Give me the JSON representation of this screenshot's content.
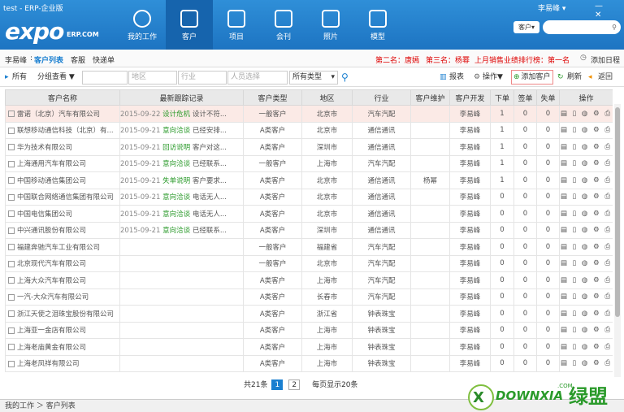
{
  "window": {
    "title": "test - ERP-企业版",
    "controls": "— ✕"
  },
  "logo": {
    "text": "expo",
    "sub": "ERP.COM"
  },
  "nav": [
    {
      "label": "我的工作",
      "icon": "person-icon"
    },
    {
      "label": "客户",
      "icon": "bag-icon",
      "active": true
    },
    {
      "label": "项目",
      "icon": "grid-icon"
    },
    {
      "label": "会刊",
      "icon": "book-icon"
    },
    {
      "label": "照片",
      "icon": "photo-icon"
    },
    {
      "label": "模型",
      "icon": "cube-icon"
    }
  ],
  "user": "李易峰 ▾",
  "search": {
    "scope": "客户",
    "scope_arrow": "▾",
    "placeholder": "",
    "icon": "search-icon"
  },
  "crumbs": {
    "user": "李易峰",
    "sep": ":",
    "current": "客户列表",
    "b": "客服",
    "c": "快递单"
  },
  "ranking": {
    "second": "第二名：唐嫣",
    "third": "第三名：杨幂",
    "month": "上月销售业绩排行榜：第一名"
  },
  "add_schedule": "添加日程",
  "toolbar": {
    "all": "所有",
    "group": "分组查看 ▼",
    "region": "地区",
    "industry": "行业",
    "person": "人员选择",
    "type": "所有类型",
    "type_arrow": "▾",
    "report": "报表",
    "operate": "操作▼",
    "add_client": "添加客户",
    "refresh": "刷新",
    "back": "返回"
  },
  "table": {
    "headers": [
      "客户名称",
      "最新跟踪记录",
      "客户类型",
      "地区",
      "行业",
      "客户维护",
      "客户开发",
      "下单",
      "签单",
      "失单",
      "操作"
    ],
    "rows": [
      {
        "name": "雷诺（北京）汽车有限公司",
        "date": "2015-09-22",
        "status": "设计危机",
        "note": "设计不符...",
        "type": "一般客户",
        "region": "北京市",
        "industry": "汽车汽配",
        "keeper": "",
        "dev": "李易峰",
        "order": "1",
        "sign": "0",
        "lose": "0"
      },
      {
        "name": "联想移动通信科技（北京）有...",
        "date": "2015-09-21",
        "status": "意向洽谈",
        "note": "已经安排...",
        "type": "A类客户",
        "region": "北京市",
        "industry": "通信通讯",
        "keeper": "",
        "dev": "李易峰",
        "order": "1",
        "sign": "0",
        "lose": "0"
      },
      {
        "name": "华为技术有限公司",
        "date": "2015-09-21",
        "status": "回访说明",
        "note": "客户对这...",
        "type": "A类客户",
        "region": "深圳市",
        "industry": "通信通讯",
        "keeper": "",
        "dev": "李易峰",
        "order": "1",
        "sign": "0",
        "lose": "0"
      },
      {
        "name": "上海通用汽车有限公司",
        "date": "2015-09-21",
        "status": "意向洽谈",
        "note": "已经联系...",
        "type": "一般客户",
        "region": "上海市",
        "industry": "汽车汽配",
        "keeper": "",
        "dev": "李易峰",
        "order": "1",
        "sign": "0",
        "lose": "0"
      },
      {
        "name": "中国移动通信集团公司",
        "date": "2015-09-21",
        "status": "失单说明",
        "note": "客户要求...",
        "type": "A类客户",
        "region": "北京市",
        "industry": "通信通讯",
        "keeper": "杨幂",
        "dev": "李易峰",
        "order": "1",
        "sign": "0",
        "lose": "0"
      },
      {
        "name": "中国联合网络通信集团有限公司",
        "date": "2015-09-21",
        "status": "意向洽谈",
        "note": "电话无人...",
        "type": "A类客户",
        "region": "北京市",
        "industry": "通信通讯",
        "keeper": "",
        "dev": "李易峰",
        "order": "0",
        "sign": "0",
        "lose": "0"
      },
      {
        "name": "中国电信集团公司",
        "date": "2015-09-21",
        "status": "意向洽谈",
        "note": "电话无人...",
        "type": "A类客户",
        "region": "北京市",
        "industry": "通信通讯",
        "keeper": "",
        "dev": "李易峰",
        "order": "0",
        "sign": "0",
        "lose": "0"
      },
      {
        "name": "中兴通讯股份有限公司",
        "date": "2015-09-21",
        "status": "意向洽谈",
        "note": "已经联系...",
        "type": "A类客户",
        "region": "深圳市",
        "industry": "通信通讯",
        "keeper": "",
        "dev": "李易峰",
        "order": "0",
        "sign": "0",
        "lose": "0"
      },
      {
        "name": "福建奔驰汽车工业有限公司",
        "date": "",
        "status": "",
        "note": "",
        "type": "一般客户",
        "region": "福建省",
        "industry": "汽车汽配",
        "keeper": "",
        "dev": "李易峰",
        "order": "0",
        "sign": "0",
        "lose": "0"
      },
      {
        "name": "北京现代汽车有限公司",
        "date": "",
        "status": "",
        "note": "",
        "type": "一般客户",
        "region": "北京市",
        "industry": "汽车汽配",
        "keeper": "",
        "dev": "李易峰",
        "order": "0",
        "sign": "0",
        "lose": "0"
      },
      {
        "name": "上海大众汽车有限公司",
        "date": "",
        "status": "",
        "note": "",
        "type": "A类客户",
        "region": "上海市",
        "industry": "汽车汽配",
        "keeper": "",
        "dev": "李易峰",
        "order": "0",
        "sign": "0",
        "lose": "0"
      },
      {
        "name": "一汽-大众汽车有限公司",
        "date": "",
        "status": "",
        "note": "",
        "type": "A类客户",
        "region": "长春市",
        "industry": "汽车汽配",
        "keeper": "",
        "dev": "李易峰",
        "order": "0",
        "sign": "0",
        "lose": "0"
      },
      {
        "name": "浙江天使之泪珠宝股份有限公司",
        "date": "",
        "status": "",
        "note": "",
        "type": "A类客户",
        "region": "浙江省",
        "industry": "钟表珠宝",
        "keeper": "",
        "dev": "李易峰",
        "order": "0",
        "sign": "0",
        "lose": "0"
      },
      {
        "name": "上海亚一金店有限公司",
        "date": "",
        "status": "",
        "note": "",
        "type": "A类客户",
        "region": "上海市",
        "industry": "钟表珠宝",
        "keeper": "",
        "dev": "李易峰",
        "order": "0",
        "sign": "0",
        "lose": "0"
      },
      {
        "name": "上海老庙黄金有限公司",
        "date": "",
        "status": "",
        "note": "",
        "type": "A类客户",
        "region": "上海市",
        "industry": "钟表珠宝",
        "keeper": "",
        "dev": "李易峰",
        "order": "0",
        "sign": "0",
        "lose": "0"
      },
      {
        "name": "上海老凤祥有限公司",
        "date": "",
        "status": "",
        "note": "",
        "type": "A类客户",
        "region": "上海市",
        "industry": "钟表珠宝",
        "keeper": "",
        "dev": "李易峰",
        "order": "0",
        "sign": "0",
        "lose": "0"
      }
    ],
    "ops_icons": "▤ ▯ ◍ ⚙ ⎙"
  },
  "pager": {
    "total": "共21条",
    "p1": "1",
    "p2": "2",
    "per": "每页显示20条"
  },
  "status": "我的工作 ＞ 客户列表",
  "watermark": {
    "logo": "DOWNXIA",
    "site": "绿盟",
    "com": ".COM"
  },
  "colors": {
    "header": "#1d74c2",
    "accent": "#1a7fd0",
    "rank": "#d00000",
    "status_green": "#2a9a2a"
  }
}
